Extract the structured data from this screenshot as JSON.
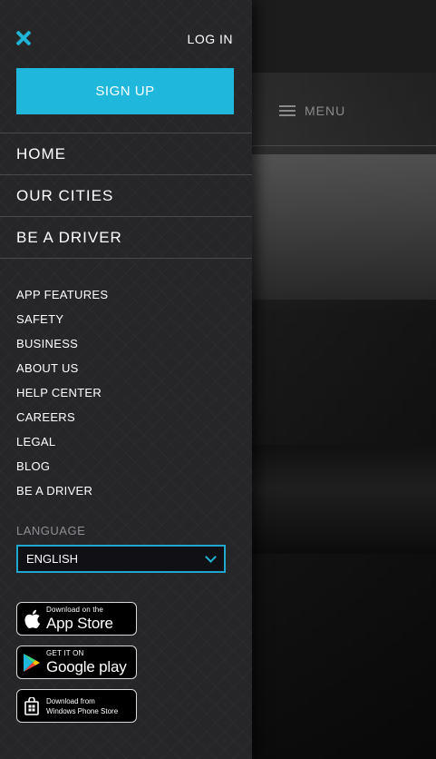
{
  "background": {
    "menu_label": "MENU"
  },
  "drawer": {
    "login_label": "LOG IN",
    "signup_label": "SIGN UP",
    "primary_nav": [
      {
        "label": "HOME"
      },
      {
        "label": "OUR CITIES"
      },
      {
        "label": "BE A DRIVER"
      }
    ],
    "secondary_nav": [
      {
        "label": "APP FEATURES"
      },
      {
        "label": "SAFETY"
      },
      {
        "label": "BUSINESS"
      },
      {
        "label": "ABOUT US"
      },
      {
        "label": "HELP CENTER"
      },
      {
        "label": "CAREERS"
      },
      {
        "label": "LEGAL"
      },
      {
        "label": "BLOG"
      },
      {
        "label": "BE A DRIVER"
      }
    ],
    "language": {
      "label": "LANGUAGE",
      "selected": "ENGLISH"
    },
    "store_badges": {
      "app_store": {
        "line1": "Download on the",
        "line2": "App Store"
      },
      "google_play": {
        "line1": "GET IT ON",
        "line2": "Google play"
      },
      "windows_phone": {
        "line1": "Download from",
        "line2": "Windows Phone Store"
      }
    }
  },
  "colors": {
    "accent": "#1fb8dc",
    "drawer_bg": "#262629"
  }
}
